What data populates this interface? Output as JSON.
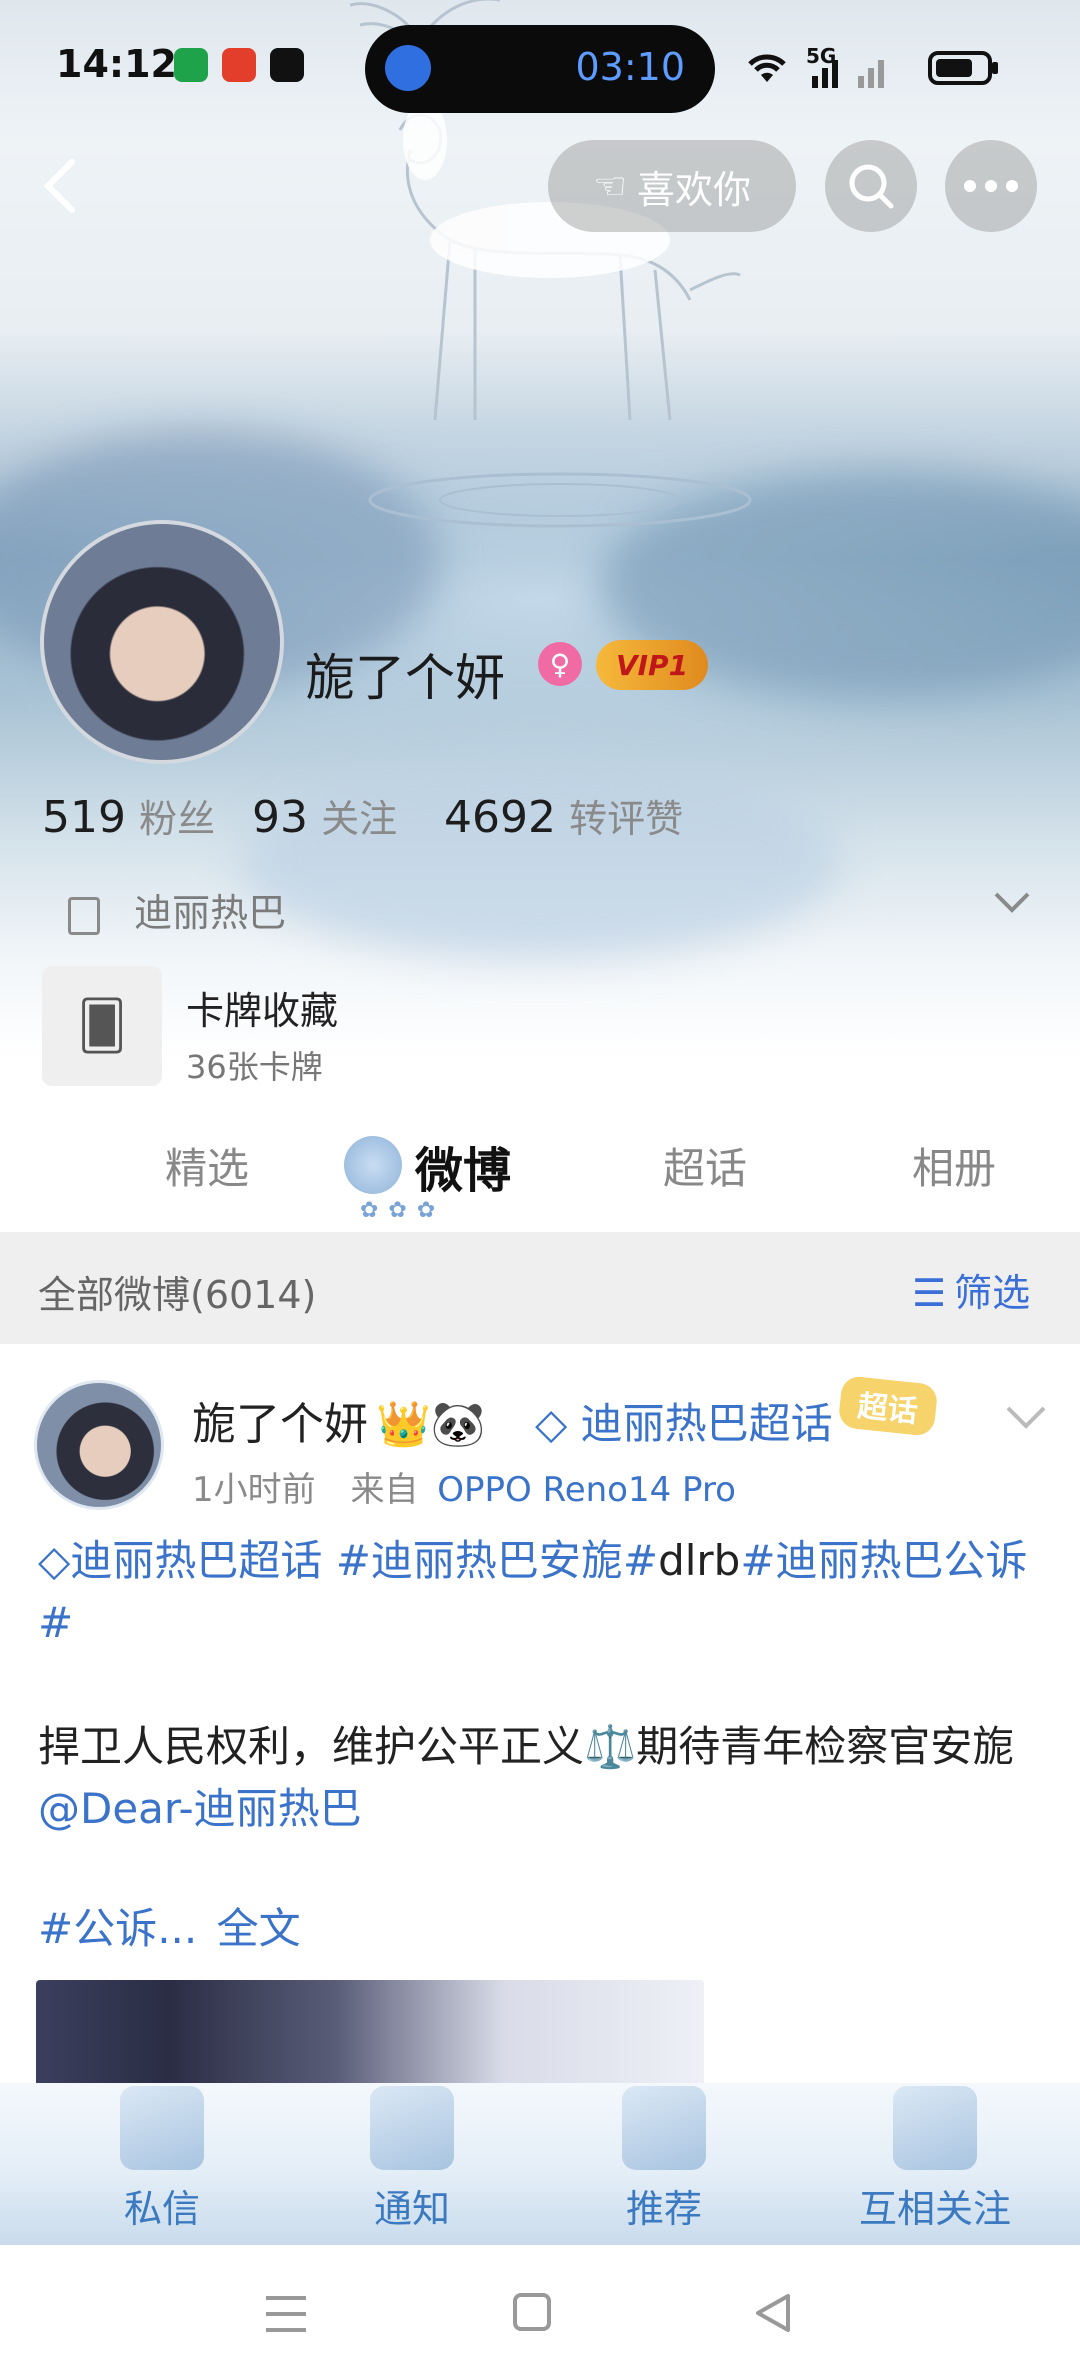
{
  "status_bar": {
    "time": "14:12",
    "timer": "03:10",
    "network": "5G"
  },
  "header": {
    "like_label": "喜欢你"
  },
  "profile": {
    "username": "旎了个妍",
    "vip": "VIP1",
    "stats": [
      {
        "value": "519",
        "label": "粉丝"
      },
      {
        "value": "93",
        "label": "关注"
      },
      {
        "value": "4692",
        "label": "转评赞"
      }
    ],
    "bio": "迪丽热巴",
    "card": {
      "title": "卡牌收藏",
      "subtitle": "36张卡牌"
    }
  },
  "tabs": [
    {
      "label": "精选"
    },
    {
      "label": "微博"
    },
    {
      "label": "超话"
    },
    {
      "label": "相册"
    }
  ],
  "feed": {
    "all_label": "全部微博(6014)",
    "filter_label": "筛选"
  },
  "post": {
    "author": "旎了个妍",
    "topic": "迪丽热巴超话",
    "badge": "超话",
    "time": "1小时前",
    "from": "来自",
    "device": "OPPO Reno14 Pro",
    "line1_topic": "迪丽热巴超话",
    "line1_tags": "#迪丽热巴安旎#",
    "line1_plain": "dlrb",
    "line1_tag2": "#迪丽热巴公诉#",
    "line2_text": "捍卫人民权利，维护公平正义⚖️期待青年检察官安旎",
    "line2_mention": "@Dear-迪丽热巴",
    "line3_tag": "#公诉...",
    "line3_more": "全文"
  },
  "bottom_nav": [
    {
      "label": "私信"
    },
    {
      "label": "通知"
    },
    {
      "label": "推荐"
    },
    {
      "label": "互相关注"
    }
  ]
}
